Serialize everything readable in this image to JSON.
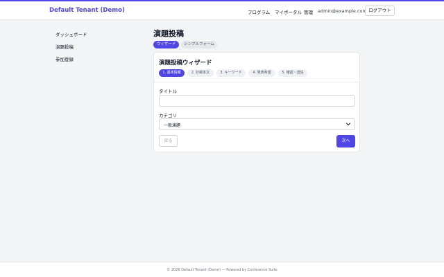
{
  "header": {
    "brand": "Default Tenant (Demo)",
    "nav": [
      "プログラム",
      "マイポータル",
      "管理"
    ],
    "user_email": "admin@example.com",
    "logout_label": "ログアウト"
  },
  "sidebar": {
    "items": [
      {
        "label": "ダッシュボード"
      },
      {
        "label": "演題投稿"
      },
      {
        "label": "参加登録"
      }
    ]
  },
  "main": {
    "title": "演題投稿",
    "mode_tabs": [
      {
        "label": "ウィザード",
        "active": true
      },
      {
        "label": "シンプルフォーム",
        "active": false
      }
    ],
    "wizard": {
      "title": "演題投稿ウィザード",
      "steps": [
        {
          "label": "1. 基本情報",
          "active": true
        },
        {
          "label": "2. 抄録本文",
          "active": false
        },
        {
          "label": "3. キーワード",
          "active": false
        },
        {
          "label": "4. 発表希望",
          "active": false
        },
        {
          "label": "5. 確認・送信",
          "active": false
        }
      ],
      "title_field": {
        "label": "タイトル",
        "value": "",
        "placeholder": ""
      },
      "category_field": {
        "label": "カテゴリ",
        "selected": "一般演題"
      },
      "back_label": "戻る",
      "next_label": "次へ"
    }
  },
  "footer": {
    "text": "© 2026 Default Tenant (Demo) — Powered by Conference Suite"
  },
  "colors": {
    "accent": "#4f46e5",
    "background": "#f3f4f6"
  }
}
